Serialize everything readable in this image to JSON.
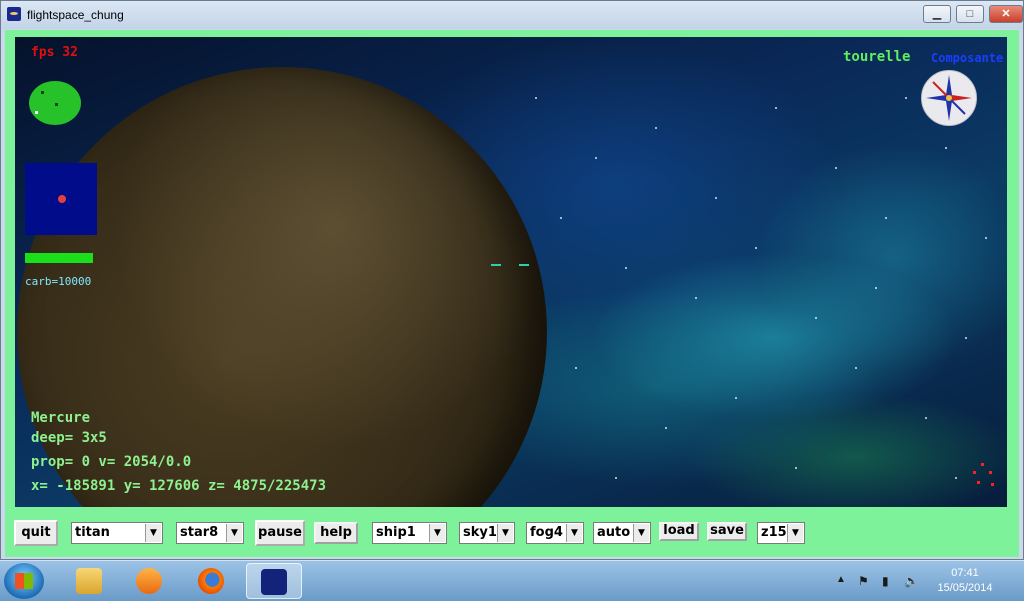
{
  "window": {
    "title": "flightspace_chung",
    "min_label": "▁",
    "max_label": "□",
    "close_label": "✕"
  },
  "hud": {
    "fps": "fps 32",
    "carb": "carb=10000",
    "tourelle": "tourelle",
    "tourelle_mode": "Composante",
    "planet_name": "Mercure",
    "deep": "deep= 3x5",
    "prop": "prop= 0  v= 2054/0.0",
    "coords": "x= -185891  y= 127606  z= 4875/225473"
  },
  "toolbar": {
    "quit": "quit",
    "planet_select": "titan",
    "star_select": "star8",
    "pause": "pause",
    "help": "help",
    "ship_select": "ship1",
    "sky_select": "sky1",
    "fog_select": "fog4",
    "mode_select": "auto",
    "load": "load",
    "save": "save",
    "zoom_select": "z15"
  },
  "taskbar": {
    "time": "07:41",
    "date": "15/05/2014",
    "items": [
      "file-explorer-icon",
      "media-player-icon",
      "firefox-icon",
      "flightspace-app-icon"
    ]
  }
}
